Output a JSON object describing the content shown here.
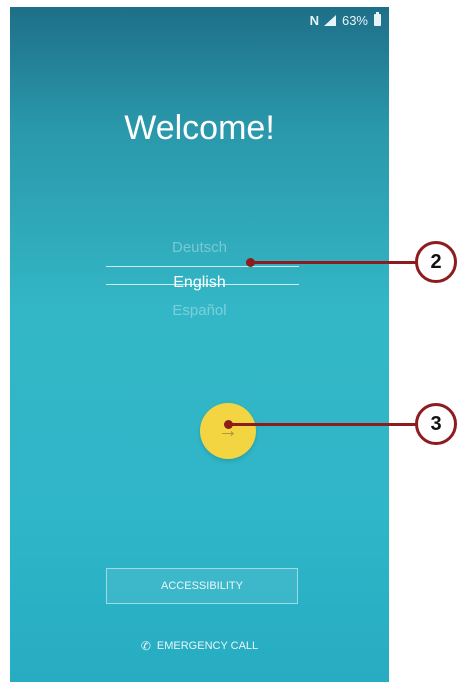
{
  "status_bar": {
    "nfc": "N",
    "battery": "63%"
  },
  "welcome_title": "Welcome!",
  "languages": [
    {
      "label": "Deutsch",
      "selected": false
    },
    {
      "label": "English",
      "selected": true
    },
    {
      "label": "Español",
      "selected": false
    }
  ],
  "next_button": {
    "glyph": "→"
  },
  "accessibility_label": "ACCESSIBILITY",
  "emergency_call_label": "EMERGENCY CALL",
  "callouts": [
    {
      "number": "2"
    },
    {
      "number": "3"
    }
  ],
  "colors": {
    "accent_yellow": "#f3d541",
    "callout_red": "#8e1b1e",
    "background_teal": "#33b7c6"
  }
}
